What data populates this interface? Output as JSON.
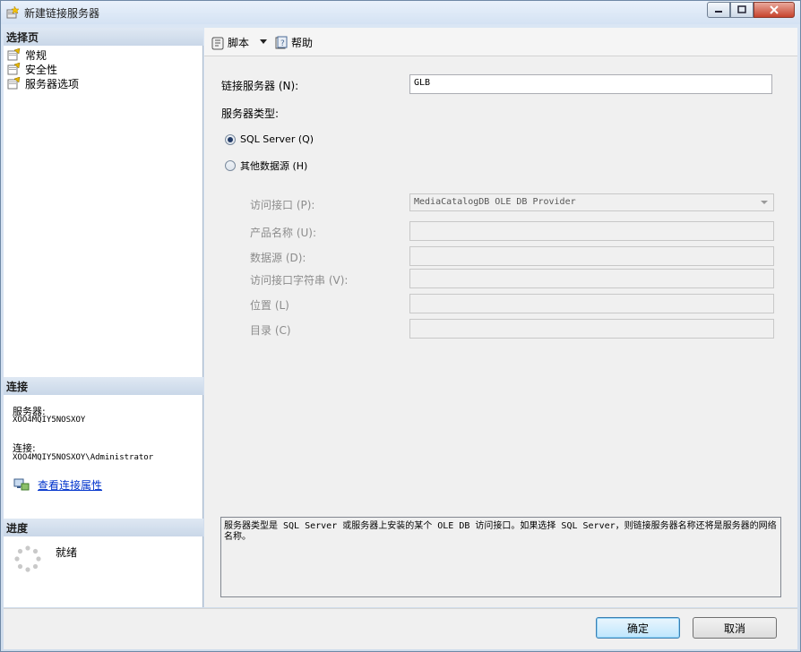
{
  "window": {
    "title": "新建链接服务器"
  },
  "left": {
    "select_page_header": "选择页",
    "pages": [
      {
        "label": "常规"
      },
      {
        "label": "安全性"
      },
      {
        "label": "服务器选项"
      }
    ],
    "connection_header": "连接",
    "server_label": "服务器:",
    "server_value": "XOO4MQIY5NOSXOY",
    "connection_label": "连接:",
    "connection_value": "XOO4MQIY5NOSXOY\\Administrator",
    "view_link": "查看连接属性",
    "progress_header": "进度",
    "progress_status": "就绪"
  },
  "toolbar": {
    "script_label": "脚本",
    "help_label": "帮助"
  },
  "form": {
    "linked_server_label": "链接服务器 (N):",
    "linked_server_value": "GLB",
    "server_type_label": "服务器类型:",
    "radio_sql_label": "SQL Server (Q)",
    "radio_other_label": "其他数据源 (H)",
    "provider_label": "访问接口 (P):",
    "provider_value": "MediaCatalogDB OLE DB Provider",
    "product_label": "产品名称 (U):",
    "datasource_label": "数据源 (D):",
    "provider_string_label": "访问接口字符串 (V):",
    "location_label": "位置 (L)",
    "catalog_label": "目录 (C)",
    "description": "服务器类型是 SQL Server 或服务器上安装的某个 OLE DB 访问接口。如果选择 SQL Server，则链接服务器名称还将是服务器的网络名称。"
  },
  "buttons": {
    "ok": "确定",
    "cancel": "取消"
  }
}
